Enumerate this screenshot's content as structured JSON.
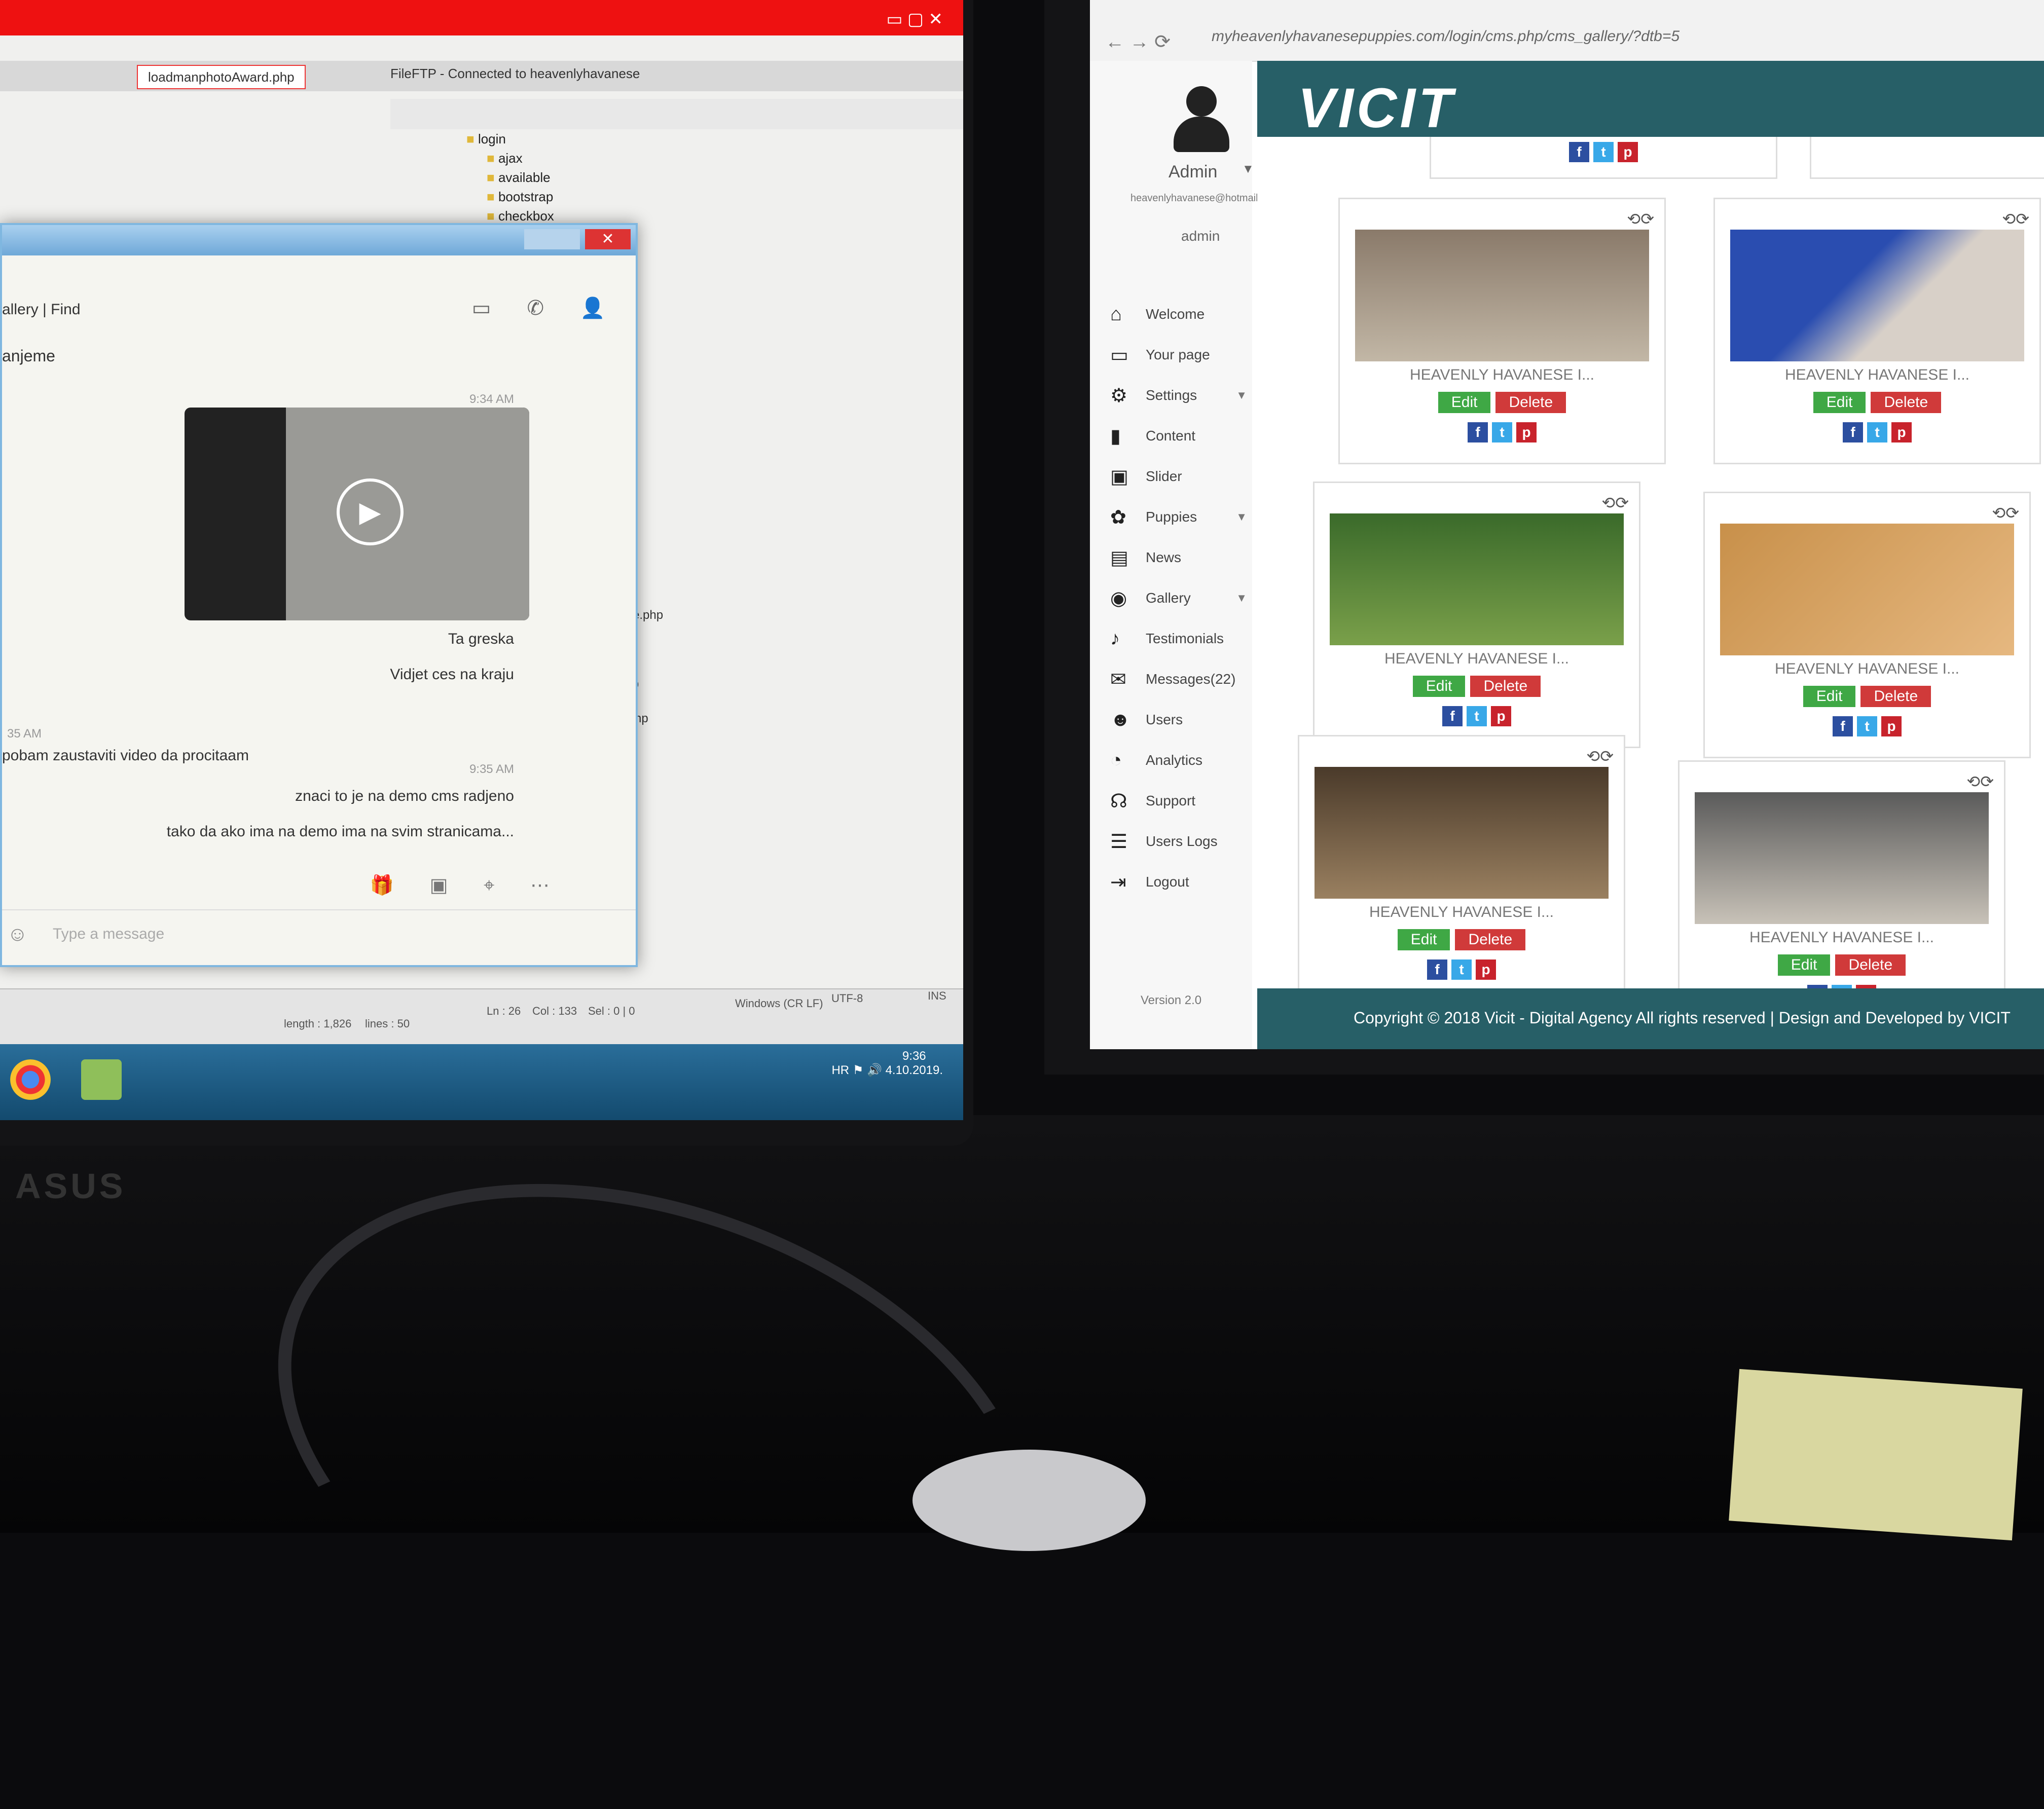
{
  "left_monitor": {
    "tabs": [
      "loadmanphotoAward.php"
    ],
    "ftp_status": "FileFTP - Connected to heavenlyhavanese",
    "tree": [
      "login",
      "ajax",
      "available",
      "bootstrap",
      "checkbox"
    ],
    "side_files": [
      "ture.php",
      "hp",
      "php",
      "s.php"
    ],
    "statusbar": {
      "length": "length : 1,826",
      "lines": "lines : 50",
      "ln": "Ln : 26",
      "col": "Col : 133",
      "sel": "Sel : 0 | 0",
      "eol": "Windows (CR LF)",
      "enc": "UTF-8",
      "ins": "INS"
    },
    "tray": {
      "lang": "HR",
      "time": "9:36",
      "date": "4.10.2019."
    },
    "brand": "ASUS"
  },
  "chat": {
    "header": "allery |  Find",
    "header2": "anjeme",
    "times": [
      "9:34 AM",
      "35 AM",
      "9:35 AM"
    ],
    "messages": [
      "Ta greska",
      "Vidjet ces  na kraju",
      "pobam zaustaviti video da procitaam",
      "znaci to je na demo cms radjeno",
      "tako da ako ima na demo ima na svim stranicama..."
    ],
    "input_placeholder": "Type a message"
  },
  "browser": {
    "url": "myheavenlyhavanesepuppies.com/login/cms.php/cms_gallery/?dtb=5"
  },
  "admin": {
    "name": "Admin",
    "email": "heavenlyhavanese@hotmail.com",
    "role": "admin",
    "menu": [
      {
        "icon": "home-icon",
        "label": "Welcome",
        "caret": false
      },
      {
        "icon": "monitor-icon",
        "label": "Your page",
        "caret": false
      },
      {
        "icon": "gear-icon",
        "label": "Settings",
        "caret": true
      },
      {
        "icon": "file-icon",
        "label": "Content",
        "caret": false
      },
      {
        "icon": "image-icon",
        "label": "Slider",
        "caret": false
      },
      {
        "icon": "paw-icon",
        "label": "Puppies",
        "caret": true
      },
      {
        "icon": "newspaper-icon",
        "label": "News",
        "caret": false
      },
      {
        "icon": "camera-icon",
        "label": "Gallery",
        "caret": true
      },
      {
        "icon": "bell-icon",
        "label": "Testimonials",
        "caret": false
      },
      {
        "icon": "envelope-icon",
        "label": "Messages(22)",
        "caret": false
      },
      {
        "icon": "users-icon",
        "label": "Users",
        "caret": false
      },
      {
        "icon": "pie-chart-icon",
        "label": "Analytics",
        "caret": false
      },
      {
        "icon": "headset-icon",
        "label": "Support",
        "caret": false
      },
      {
        "icon": "list-icon",
        "label": "Users Logs",
        "caret": false
      },
      {
        "icon": "logout-icon",
        "label": "Logout",
        "caret": false
      }
    ],
    "version": "Version 2.0"
  },
  "site": {
    "logo": "VICIT",
    "card_title": "HEAVENLY HAVANESE I...",
    "edit_label": "Edit",
    "delete_label": "Delete",
    "social": [
      "f",
      "t",
      "p"
    ],
    "footer": "Copyright © 2018 Vicit - Digital Agency All rights reserved | Design and Developed by VICIT"
  },
  "colors": {
    "teal": "#275f67",
    "edit_green": "#3fa845",
    "delete_red": "#d03a3a"
  }
}
